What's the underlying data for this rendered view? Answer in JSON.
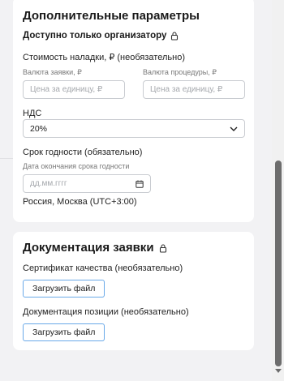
{
  "section_params": {
    "title": "Дополнительные параметры",
    "organizer_only": "Доступно только организатору",
    "setup_cost_label": "Стоимость наладки, ₽ (необязательно)",
    "bid_currency_label": "Валюта заявки, ₽",
    "bid_currency_placeholder": "Цена за единицу, ₽",
    "procedure_currency_label": "Валюта процедуры, ₽",
    "procedure_currency_placeholder": "Цена за единицу, ₽",
    "vat_label": "НДС",
    "vat_value": "20%",
    "shelf_life_label": "Срок годности (обязательно)",
    "expiry_date_label": "Дата окончания срока годности",
    "expiry_date_placeholder": "дд.мм.гггг",
    "timezone_note": "Россия, Москва (UTC+3:00)"
  },
  "section_docs": {
    "title": "Документация заявки",
    "quality_cert_label": "Сертификат качества (необязательно)",
    "upload_button_1": "Загрузить файл",
    "position_docs_label": "Документация позиции (необязательно)",
    "upload_button_2": "Загрузить файл"
  },
  "icons": [
    "lock-icon",
    "chevron-down-icon",
    "calendar-icon"
  ],
  "colors": {
    "accent_border": "#6aa9e8",
    "scroll_thumb": "#6d6d6d"
  }
}
